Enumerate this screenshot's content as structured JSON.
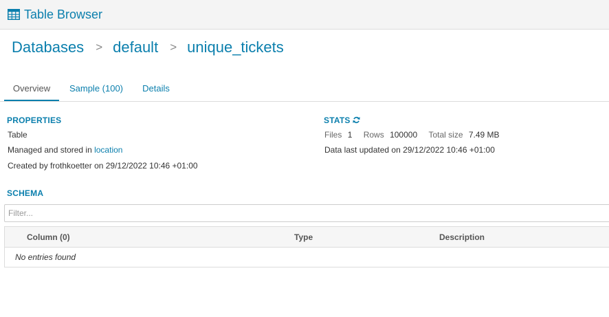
{
  "header": {
    "icon": "table-grid-icon",
    "title": "Table Browser"
  },
  "breadcrumb": {
    "items": [
      "Databases",
      "default",
      "unique_tickets"
    ],
    "separator": ">"
  },
  "tabs": [
    {
      "label": "Overview",
      "active": true
    },
    {
      "label": "Sample (100)",
      "active": false
    },
    {
      "label": "Details",
      "active": false
    }
  ],
  "properties": {
    "title": "PROPERTIES",
    "type_line": "Table",
    "managed_prefix": "Managed and stored in ",
    "managed_link": "location",
    "created_line": "Created by frothkoetter on 29/12/2022 10:46 +01:00"
  },
  "stats": {
    "title": "STATS",
    "icon": "refresh-icon",
    "files_label": "Files",
    "files_value": "1",
    "rows_label": "Rows",
    "rows_value": "100000",
    "size_label": "Total size",
    "size_value": "7.49 MB",
    "updated_line": "Data last updated on 29/12/2022 10:46 +01:00"
  },
  "schema": {
    "title": "SCHEMA",
    "filter_placeholder": "Filter...",
    "columns": [
      "Column (0)",
      "Type",
      "Description"
    ],
    "empty_text": "No entries found"
  },
  "colors": {
    "accent": "#0b7fad",
    "header_bg": "#f4f4f4",
    "text": "#333333"
  }
}
